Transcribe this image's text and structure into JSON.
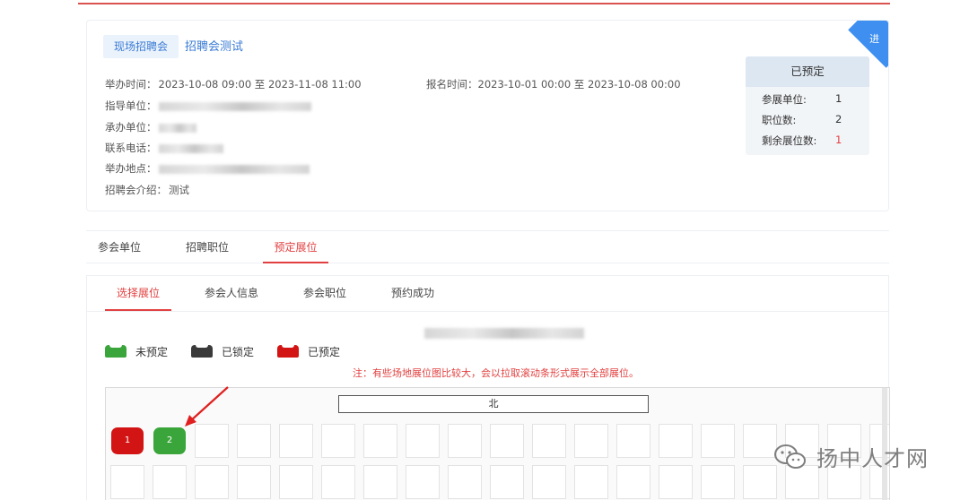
{
  "fair": {
    "type_tag": "现场招聘会",
    "title": "招聘会测试",
    "hold_time_label": "举办时间：",
    "hold_time_value": "2023-10-08 09:00 至 2023-11-08 11:00",
    "reg_time_label": "报名时间：",
    "reg_time_value": "2023-10-01 00:00 至 2023-10-08 00:00",
    "guide_label": "指导单位：",
    "host_label": "承办单位：",
    "phone_label": "联系电话：",
    "address_label": "举办地点：",
    "intro_label": "招聘会介绍：",
    "intro_value": "测试",
    "ribbon_text": "进"
  },
  "booked_box": {
    "title": "已预定",
    "rows": [
      {
        "label": "参展单位:",
        "value": "1"
      },
      {
        "label": "职位数:",
        "value": "2"
      },
      {
        "label": "剩余展位数:",
        "value": "1"
      }
    ]
  },
  "outer_tabs": [
    "参会单位",
    "招聘职位",
    "预定展位"
  ],
  "inner_tabs": [
    "选择展位",
    "参会人信息",
    "参会职位",
    "预约成功"
  ],
  "legend": [
    {
      "label": "未预定",
      "color": "#3aa53a"
    },
    {
      "label": "已锁定",
      "color": "#3a3a3a"
    },
    {
      "label": "已预定",
      "color": "#d21414"
    }
  ],
  "note": "注：有些场地展位图比较大，会以拉取滚动条形式展示全部展位。",
  "hall": {
    "direction_label": "北",
    "booths": [
      {
        "number": "1",
        "status": "已预定"
      },
      {
        "number": "2",
        "status": "未预定"
      }
    ]
  },
  "watermark": "扬中人才网"
}
